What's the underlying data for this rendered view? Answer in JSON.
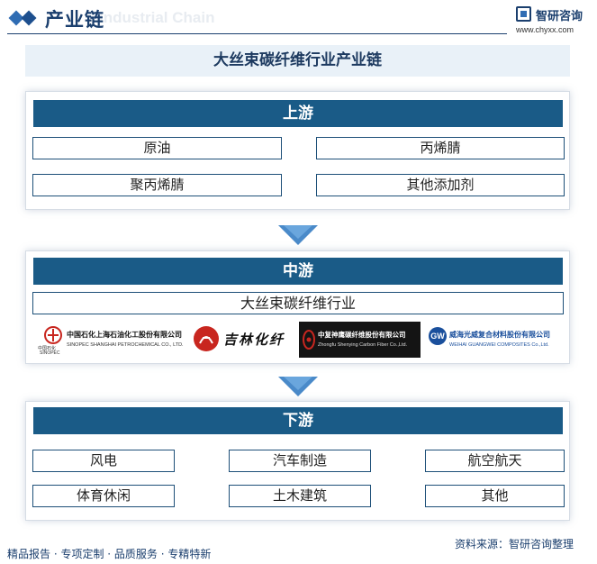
{
  "header": {
    "title": "产业链",
    "watermark": "Industrial Chain",
    "brand_name": "智研咨询",
    "brand_url": "www.chyxx.com"
  },
  "main_title": "大丝束碳纤维行业产业链",
  "upstream": {
    "label": "上游",
    "items": [
      "原油",
      "丙烯腈",
      "聚丙烯腈",
      "其他添加剂"
    ]
  },
  "midstream": {
    "label": "中游",
    "industry": "大丝束碳纤维行业",
    "companies": [
      {
        "name": "中国石化上海石油化工股份有限公司",
        "en": "SINOPEC SHANGHAI PETROCHEMICAL CO., LTD.",
        "mark": "中国石化",
        "mark_en": "SINOPEC"
      },
      {
        "name": "吉林化纤",
        "mark": "吉"
      },
      {
        "name": "中复神鹰碳纤维股份有限公司",
        "en": "Zhongfu Shenying Carbon Fiber Co.,Ltd."
      },
      {
        "name": "威海光威复合材料股份有限公司",
        "en": "WEIHAI GUANGWEI COMPOSITES Co.,Ltd.",
        "mark": "GW"
      }
    ]
  },
  "downstream": {
    "label": "下游",
    "items": [
      "风电",
      "汽车制造",
      "航空航天",
      "体育休闲",
      "土木建筑",
      "其他"
    ]
  },
  "footer": {
    "left": "精品报告 · 专项定制 · 品质服务 · 专精特新",
    "right": "资料来源：智研咨询整理"
  },
  "colors": {
    "bar": "#1a5b87",
    "arrow": "#4a8ac9",
    "title_bg": "#e9f1f8",
    "header_text": "#1b3f6e"
  }
}
